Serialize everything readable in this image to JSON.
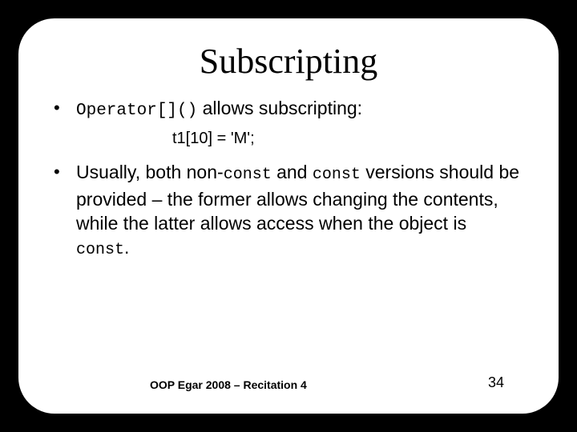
{
  "title": "Subscripting",
  "bullets": [
    {
      "code1": "Operator[]()",
      "text1": " allows subscripting:"
    },
    {
      "pre": "Usually, both non-",
      "c1": "const",
      "mid1": " and ",
      "c2": "const",
      "mid2": " versions should be provided – the former allows changing the contents, while the latter allows access when the object is ",
      "c3": "const",
      "end": "."
    }
  ],
  "example": "t1[10] = 'M';",
  "footer": "OOP Egar 2008 – Recitation 4",
  "page": "34"
}
